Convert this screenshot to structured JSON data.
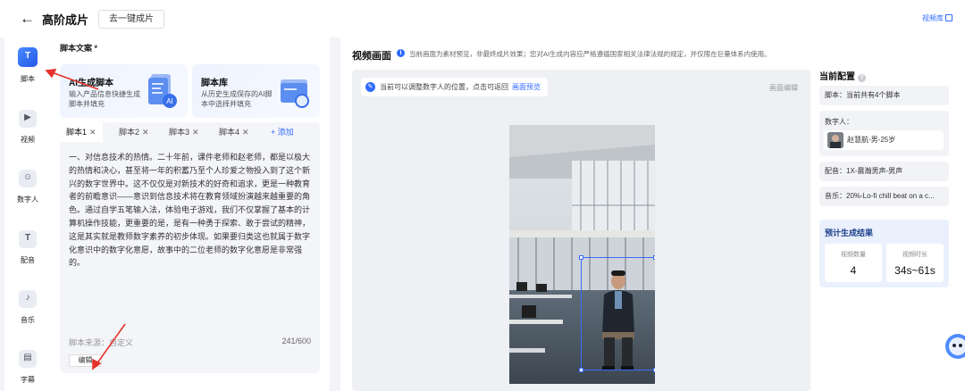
{
  "header": {
    "back_icon": "arrow-left-icon",
    "title": "高阶成片",
    "one_click_label": "去一键成片",
    "video_library_label": "视频库"
  },
  "nav": {
    "items": [
      {
        "label": "脚本",
        "icon": "script-icon",
        "glyph": "T",
        "active": true
      },
      {
        "label": "视频",
        "icon": "video-icon",
        "glyph": "▶",
        "active": false
      },
      {
        "label": "数字人",
        "icon": "digital-human-icon",
        "glyph": "☺",
        "active": false
      },
      {
        "label": "配音",
        "icon": "dubbing-icon",
        "glyph": "T",
        "active": false
      },
      {
        "label": "音乐",
        "icon": "music-icon",
        "glyph": "♪",
        "active": false
      },
      {
        "label": "字幕",
        "icon": "subtitle-icon",
        "glyph": "▤",
        "active": false
      }
    ]
  },
  "script": {
    "section_title": "脚本文案 *",
    "ai_card": {
      "title": "AI生成脚本",
      "desc": "输入产品信息快捷生成脚本并填充"
    },
    "lib_card": {
      "title": "脚本库",
      "desc": "从历史生成保存的AI脚本中选择并填充"
    },
    "tabs": [
      "脚本1",
      "脚本2",
      "脚本3",
      "脚本4"
    ],
    "add_tab_label": "+ 添加",
    "body": "一、对信息技术的热情。二十年前，课件老师和赵老师，都是以极大的热情和决心，甚至将一年的积蓄乃至个人珍爱之物投入到了这个新兴的数字世界中。这不仅仅是对新技术的好奇和追求，更是一种教育者的前瞻意识——意识到信息技术将在教育领域扮演越来越重要的角色。通过自学五笔输入法，体验电子游戏，我们不仅掌握了基本的计算机操作技能，更重要的是，是有一种勇于探索、敢于尝试的精神，这是其实就是教师数字素养的初步体现。如果要归类这也就属于数字化意识中的数字化意愿，故事中的二位老师的数字化意愿是非常强的。",
    "source_label": "脚本来源：自定义",
    "char_count": "241/600",
    "edit_label": "编辑"
  },
  "video": {
    "title": "视频画面",
    "note": "当前画面为素材预览，非最终成片效果；您对AI生成内容应严格遵循国家相关法律法规的规定，并仅限在巨量体系内使用。",
    "hint": "当前可以调整数字人的位置，点击可返回",
    "hint_link": "画面预览",
    "edit_label": "画面编辑"
  },
  "config": {
    "title": "当前配置",
    "script_line": "脚本：当前共有4个脚本",
    "digital_human_label": "数字人：",
    "digital_human_value": "赵慧航-男-25岁",
    "voice_line": "配音：1X-晨瀚男声-男声",
    "music_line": "音乐：20%-Lo-fi chill beat on a c...",
    "result_title": "预计生成结果",
    "stats": [
      {
        "label": "视频数量",
        "value": "4"
      },
      {
        "label": "视频时长",
        "value": "34s~61s"
      }
    ]
  },
  "colors": {
    "accent": "#2f6bff",
    "panel": "#ffffff",
    "background": "#f3f4f7"
  }
}
